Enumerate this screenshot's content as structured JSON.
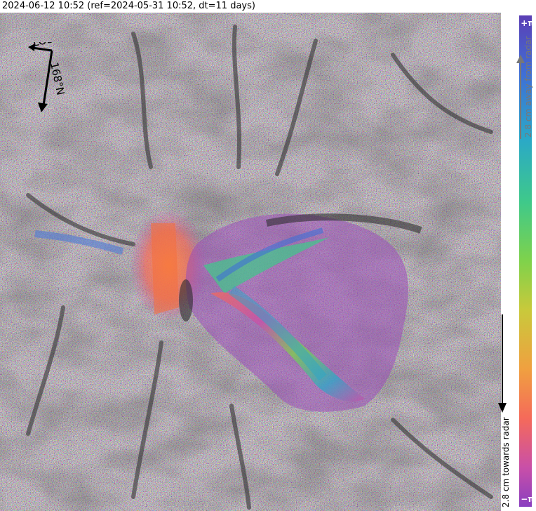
{
  "header": {
    "title": "2024-06-12 10:52 (ref=2024-05-31 10:52, dt=11 days)"
  },
  "compass": {
    "los_label": "LOS",
    "heading_label": "168°N",
    "north_label": ""
  },
  "colorbar": {
    "top_label": "+π",
    "bottom_label": "−π",
    "away_label": "2.8 cm away from radar",
    "towards_label": "2.8 cm towards radar",
    "colors": [
      "#5b3fb5",
      "#3f6fd6",
      "#2aa8c8",
      "#3fc98a",
      "#7fd24b",
      "#c9c93b",
      "#f0a040",
      "#f56a5a",
      "#c94fa8",
      "#8a3fc0"
    ]
  }
}
